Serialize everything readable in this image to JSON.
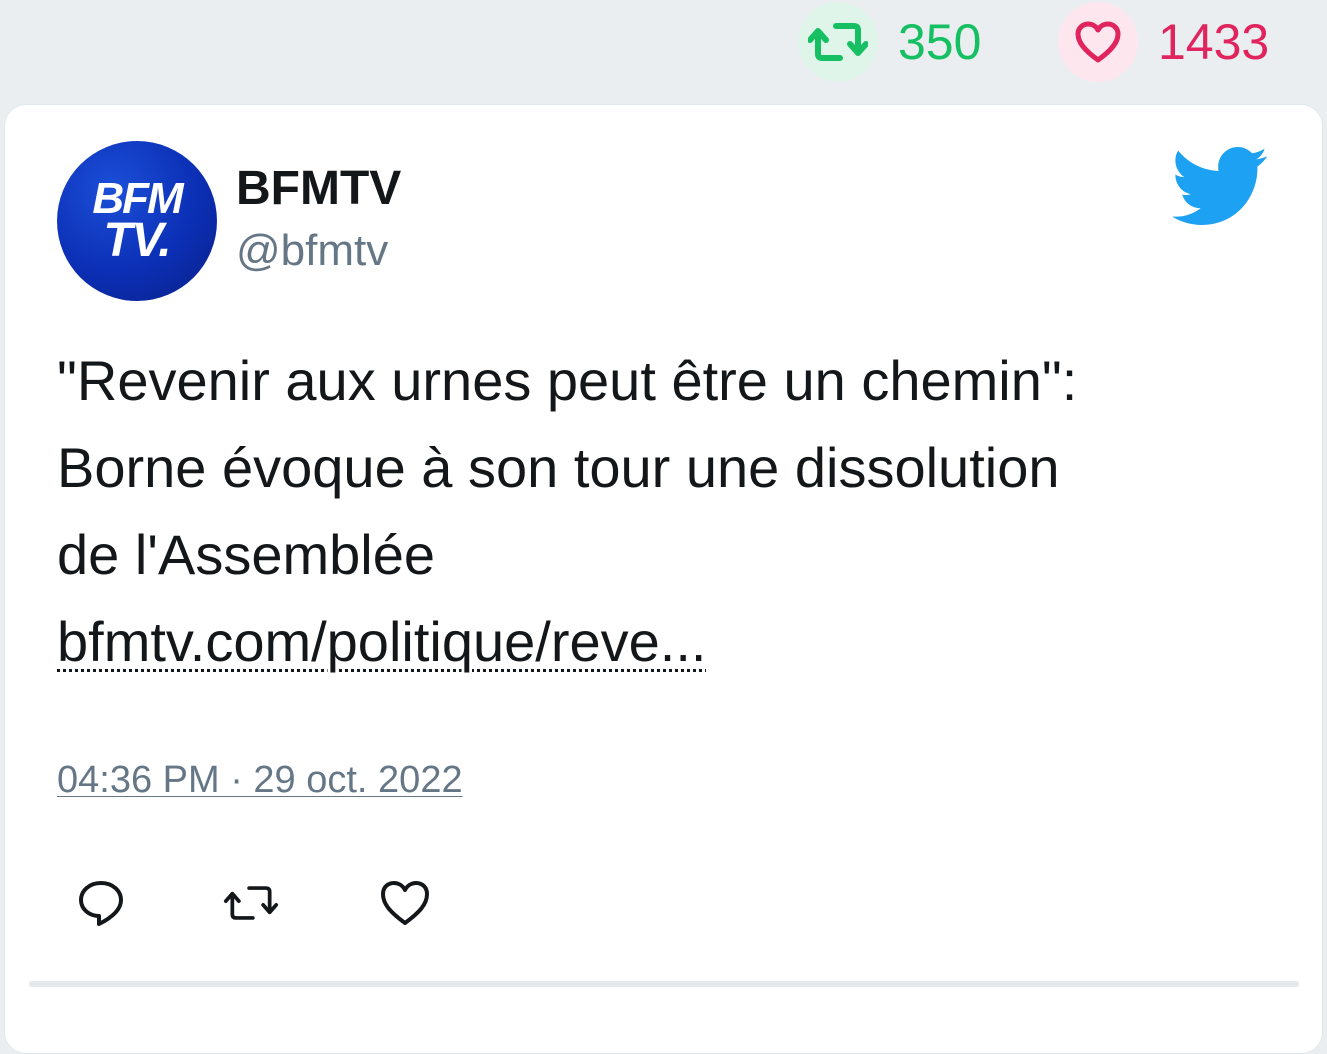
{
  "stats": {
    "retweets": {
      "icon": "retweet-icon",
      "count": "350",
      "color": "#17bf63"
    },
    "likes": {
      "icon": "heart-icon",
      "count": "1433",
      "color": "#e0245e"
    }
  },
  "tweet": {
    "author": {
      "name": "BFMTV",
      "handle": "@bfmtv",
      "avatar_logo_line1": "BFM",
      "avatar_logo_line2": "TV."
    },
    "brand_icon": "twitter-bird-icon",
    "text_lines": [
      "\"Revenir aux urnes peut être un chemin\":",
      "Borne évoque à son tour une dissolution",
      "de l'Assemblée"
    ],
    "link": "bfmtv.com/politique/reve...",
    "timestamp": "04:36 PM · 29 oct. 2022",
    "actions": [
      {
        "name": "reply",
        "icon": "reply-icon"
      },
      {
        "name": "retweet",
        "icon": "retweet-icon"
      },
      {
        "name": "like",
        "icon": "heart-icon"
      }
    ]
  },
  "colors": {
    "twitter_blue": "#1da1f2",
    "text": "#14171a",
    "secondary_text": "#657786",
    "page_bg": "#ebeef0"
  }
}
